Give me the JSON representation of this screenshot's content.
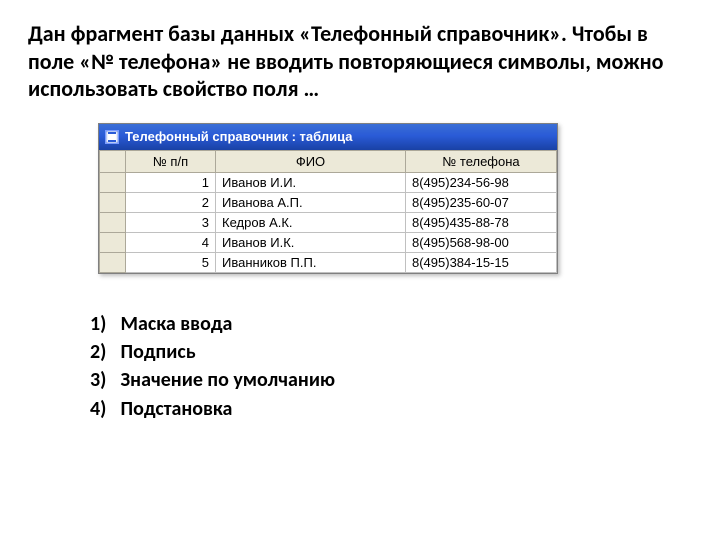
{
  "question": "Дан фрагмент базы данных «Телефонный справочник». Чтобы в поле «№ телефона» не вводить повторяющиеся символы, можно использовать свойство поля …",
  "window": {
    "title": "Телефонный справочник : таблица",
    "columns": [
      "№ п/п",
      "ФИО",
      "№ телефона"
    ],
    "rows": [
      {
        "n": "1",
        "fio": "Иванов И.И.",
        "phone": "8(495)234-56-98"
      },
      {
        "n": "2",
        "fio": "Иванова А.П.",
        "phone": "8(495)235-60-07"
      },
      {
        "n": "3",
        "fio": "Кедров А.К.",
        "phone": "8(495)435-88-78"
      },
      {
        "n": "4",
        "fio": "Иванов И.К.",
        "phone": "8(495)568-98-00"
      },
      {
        "n": "5",
        "fio": "Иванников П.П.",
        "phone": "8(495)384-15-15"
      }
    ]
  },
  "answers": [
    {
      "n": "1)",
      "text": "Маска ввода"
    },
    {
      "n": "2)",
      "text": "Подпись"
    },
    {
      "n": "3)",
      "text": "Значение по умолчанию"
    },
    {
      "n": "4)",
      "text": "Подстановка"
    }
  ]
}
